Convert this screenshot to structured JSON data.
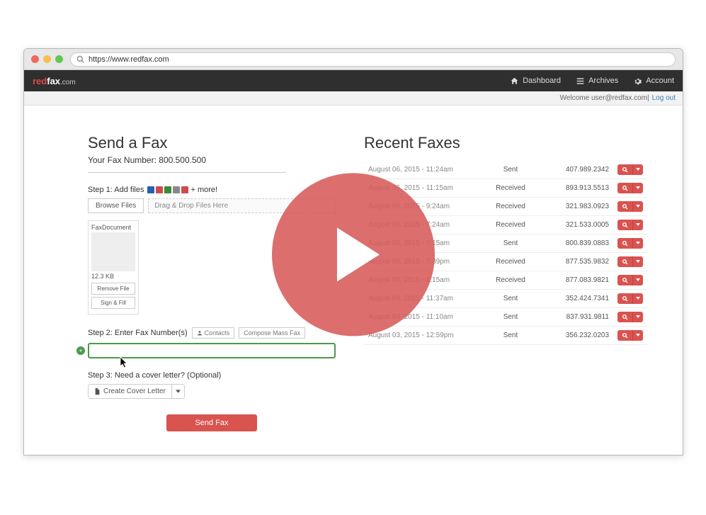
{
  "browser": {
    "url": "https://www.redfax.com"
  },
  "brand": {
    "part1": "red",
    "part2": "fax",
    "suffix": ".com"
  },
  "nav": {
    "dashboard": "Dashboard",
    "archives": "Archives",
    "account": "Account"
  },
  "subheader": {
    "welcome": "Welcome user@redfax.com",
    "divider": " | ",
    "logout": "Log out"
  },
  "send": {
    "title": "Send a Fax",
    "your_number_label": "Your Fax Number: ",
    "your_number": "800.500.500",
    "step1": "Step 1: Add files",
    "step1_more": " + more!",
    "browse": "Browse Files",
    "dropzone": "Drag & Drop Files Here",
    "file": {
      "name": "FaxDocument",
      "size": "12.3 KB",
      "remove": "Remove File",
      "sign": "Sign & Fill"
    },
    "step2": "Step 2: Enter Fax Number(s)",
    "contacts": "Contacts",
    "mass": "Compose Mass Fax",
    "step3": "Step 3: Need a cover letter? (Optional)",
    "cover": "Create Cover Letter",
    "send_btn": "Send Fax"
  },
  "recent": {
    "title": "Recent Faxes",
    "rows": [
      {
        "date": "August 06, 2015 - 11:24am",
        "status": "Sent",
        "phone": "407.989.2342"
      },
      {
        "date": "August 06, 2015 - 11:15am",
        "status": "Received",
        "phone": "893.913.5513"
      },
      {
        "date": "August 06, 2015 - 9:24am",
        "status": "Received",
        "phone": "321.983.0923"
      },
      {
        "date": "August 06, 2015 - 7:24am",
        "status": "Received",
        "phone": "321.533.0005"
      },
      {
        "date": "August 06, 2015 - 7:15am",
        "status": "Sent",
        "phone": "800.839.0883"
      },
      {
        "date": "August 05, 2015 - 7:39pm",
        "status": "Received",
        "phone": "877.535.9832"
      },
      {
        "date": "August 05, 2015 - 8:15am",
        "status": "Received",
        "phone": "877.083.9821"
      },
      {
        "date": "August 04, 2015 - 11:37am",
        "status": "Sent",
        "phone": "352.424.7341"
      },
      {
        "date": "August 04, 2015 - 11:10am",
        "status": "Sent",
        "phone": "837.931.9811"
      },
      {
        "date": "August 03, 2015 - 12:59pm",
        "status": "Sent",
        "phone": "356.232.0203"
      }
    ]
  }
}
